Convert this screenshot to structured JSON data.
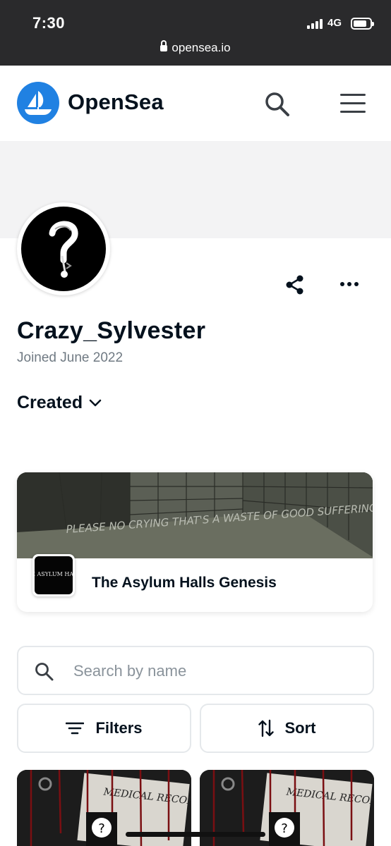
{
  "status_bar": {
    "time": "7:30",
    "network": "4G",
    "url": "opensea.io"
  },
  "header": {
    "brand": "OpenSea",
    "icons": [
      "opensea-logo-icon",
      "search-icon",
      "menu-icon"
    ],
    "brand_color": "#2081e2"
  },
  "profile": {
    "username": "Crazy_Sylvester",
    "joined": "Joined June 2022",
    "avatar_icon": "question-mark-avatar",
    "actions": [
      "share-icon",
      "more-icon"
    ]
  },
  "tabs": {
    "selected": "Created",
    "icon": "chevron-down-icon"
  },
  "collection": {
    "name": "The Asylum Halls Genesis",
    "banner_text": "PLEASE NO CRYING THAT'S A WASTE OF GOOD SUFFERING",
    "thumb_text": "THE ASYLUM HALLS"
  },
  "search": {
    "placeholder": "Search by name",
    "value": ""
  },
  "controls": {
    "filters_label": "Filters",
    "sort_label": "Sort"
  },
  "items": [
    {
      "image_text": "MEDICAL RECORD"
    },
    {
      "image_text": "MEDICAL RECORD"
    }
  ],
  "colors": {
    "text": "#04111d",
    "muted": "#707a83",
    "border": "#e5e8eb",
    "status_bar": "#2a2a2c",
    "banner": "#f3f3f4"
  }
}
